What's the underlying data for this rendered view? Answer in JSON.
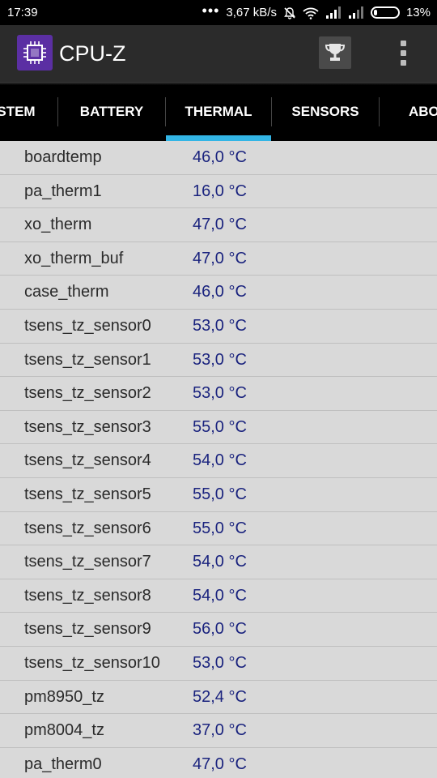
{
  "status_bar": {
    "time": "17:39",
    "dots": "•••",
    "speed": "3,67 kB/s",
    "battery": "13%",
    "battery_level": 0.13
  },
  "app": {
    "title": "CPU-Z",
    "icons": {
      "logo": "cpu-chip-icon",
      "trophy": "trophy-icon",
      "menu": "overflow-menu-icon"
    },
    "accent_color": "#33b5e5",
    "logo_color": "#5b2fa3",
    "value_color": "#1a237e"
  },
  "tabs": [
    {
      "label": "STEM"
    },
    {
      "label": "BATTERY"
    },
    {
      "label": "THERMAL",
      "active": true
    },
    {
      "label": "SENSORS"
    },
    {
      "label": "ABO"
    }
  ],
  "thermal": [
    {
      "name": "boardtemp",
      "value": "46,0 °C"
    },
    {
      "name": "pa_therm1",
      "value": "16,0 °C"
    },
    {
      "name": "xo_therm",
      "value": "47,0 °C"
    },
    {
      "name": "xo_therm_buf",
      "value": "47,0 °C"
    },
    {
      "name": "case_therm",
      "value": "46,0 °C"
    },
    {
      "name": "tsens_tz_sensor0",
      "value": "53,0 °C"
    },
    {
      "name": "tsens_tz_sensor1",
      "value": "53,0 °C"
    },
    {
      "name": "tsens_tz_sensor2",
      "value": "53,0 °C"
    },
    {
      "name": "tsens_tz_sensor3",
      "value": "55,0 °C"
    },
    {
      "name": "tsens_tz_sensor4",
      "value": "54,0 °C"
    },
    {
      "name": "tsens_tz_sensor5",
      "value": "55,0 °C"
    },
    {
      "name": "tsens_tz_sensor6",
      "value": "55,0 °C"
    },
    {
      "name": "tsens_tz_sensor7",
      "value": "54,0 °C"
    },
    {
      "name": "tsens_tz_sensor8",
      "value": "54,0 °C"
    },
    {
      "name": "tsens_tz_sensor9",
      "value": "56,0 °C"
    },
    {
      "name": "tsens_tz_sensor10",
      "value": "53,0 °C"
    },
    {
      "name": "pm8950_tz",
      "value": "52,4 °C"
    },
    {
      "name": "pm8004_tz",
      "value": "37,0 °C"
    },
    {
      "name": "pa_therm0",
      "value": "47,0 °C"
    }
  ]
}
